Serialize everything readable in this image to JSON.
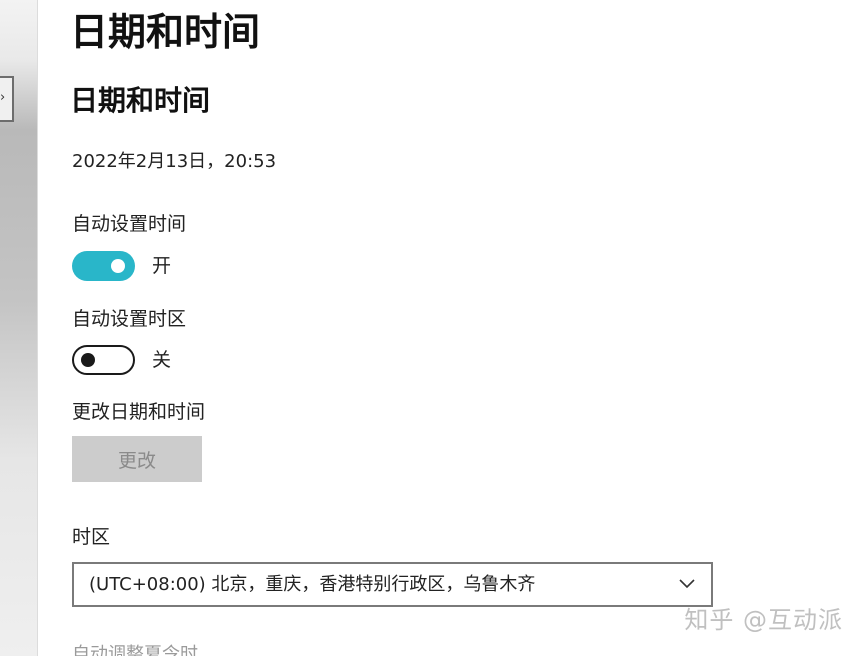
{
  "page": {
    "title": "日期和时间",
    "section_title": "日期和时间",
    "current_datetime": "2022年2月13日，20:53"
  },
  "auto_time": {
    "label": "自动设置时间",
    "state_label": "开",
    "on": true
  },
  "auto_timezone": {
    "label": "自动设置时区",
    "state_label": "关",
    "on": false
  },
  "change_datetime": {
    "label": "更改日期和时间",
    "button_label": "更改",
    "enabled": false
  },
  "timezone": {
    "label": "时区",
    "selected": "(UTC+08:00) 北京，重庆，香港特别行政区，乌鲁木齐"
  },
  "truncated_next_label": "自动调整夏令时",
  "watermark": "知乎 @互动派",
  "colors": {
    "toggle_on": "#29b6c9",
    "button_disabled_bg": "#cccccc",
    "button_disabled_text": "#8a8a8a"
  },
  "icons": {
    "back": "back-arrow-icon",
    "dropdown": "chevron-down-icon"
  }
}
